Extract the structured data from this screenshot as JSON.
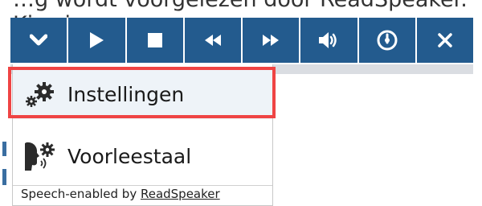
{
  "snippet": {
    "text": "…g wordt voorgelezen door ReadSpeaker. Kies je…"
  },
  "toolbar": {
    "buttons": [
      {
        "icon": "chevron-down-icon"
      },
      {
        "icon": "play-icon"
      },
      {
        "icon": "stop-icon"
      },
      {
        "icon": "rewind-icon"
      },
      {
        "icon": "fast-forward-icon"
      },
      {
        "icon": "volume-icon"
      },
      {
        "icon": "speed-icon"
      },
      {
        "icon": "close-icon"
      }
    ],
    "colors": {
      "background": "#235b8e",
      "separator": "#ffffff"
    }
  },
  "menu": {
    "settings_label": "Instellingen",
    "voice_label": "Voorleestaal",
    "footer_prefix": "Speech-enabled by ",
    "footer_link": "ReadSpeaker",
    "highlight_color": "#ef4444"
  }
}
